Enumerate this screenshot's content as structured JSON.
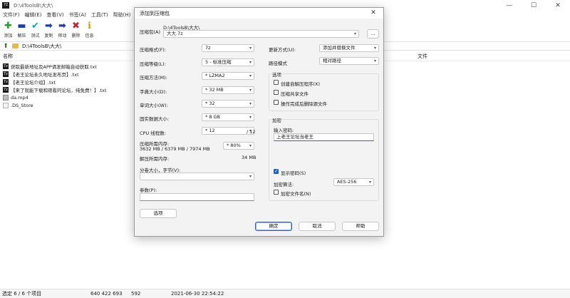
{
  "window": {
    "title": "D:\\4ToolsB\\大大\\",
    "icon_text": "7Z"
  },
  "menu": [
    "文件(F)",
    "编辑(E)",
    "查看(V)",
    "书签(A)",
    "工具(T)",
    "帮助(H)"
  ],
  "toolbar": [
    {
      "label": "添加",
      "icon": "plus-icon",
      "glyph": "✚",
      "color": "#2e9e2e"
    },
    {
      "label": "解压",
      "icon": "minus-icon",
      "glyph": "▬",
      "color": "#1f3fa8"
    },
    {
      "label": "测试",
      "icon": "check-icon",
      "glyph": "✔",
      "color": "#1aa3a3"
    },
    {
      "label": "复制",
      "icon": "arrow-right-icon",
      "glyph": "➡",
      "color": "#1f3fa8"
    },
    {
      "label": "移动",
      "icon": "arrow-right-icon",
      "glyph": "➡",
      "color": "#1f3fa8"
    },
    {
      "label": "删除",
      "icon": "delete-icon",
      "glyph": "✖",
      "color": "#c0262d"
    },
    {
      "label": "信息",
      "icon": "info-icon",
      "glyph": "ℹ",
      "color": "#c8a400"
    }
  ],
  "path": "D:\\4ToolsB\\大大\\",
  "list_header": {
    "name": "名称",
    "type": "文件"
  },
  "files": [
    {
      "name": "获取最新地址及APP请发邮箱自动获取.txt",
      "kind": "txt"
    },
    {
      "name": "【老王论坛永久地址发布页】.txt",
      "kind": "txt"
    },
    {
      "name": "【老王论坛介绍】.txt",
      "kind": "txt"
    },
    {
      "name": "【来了就能下载和观看的论坛，纯免费！】.txt",
      "kind": "txt"
    },
    {
      "name": "da.mp4",
      "kind": "mp4"
    },
    {
      "name": ".DS_Store",
      "kind": "ds"
    }
  ],
  "statusbar": {
    "selection": "选定 6 / 6 个项目",
    "size": "640 422 693",
    "packed": "592",
    "modified": "2021-06-30 22:54:22"
  },
  "dialog": {
    "title": "添加到压缩包",
    "archive_label": "压缩包(A)",
    "archive_dir": "D:\\4ToolsB\\大大\\",
    "archive_name": "大大.7z",
    "browse_label": "...",
    "format_label": "压缩格式(F):",
    "format_value": "7z",
    "level_label": "压缩等级(L):",
    "level_value": "5 - 标准压缩",
    "method_label": "压缩方法(M):",
    "method_value": "* LZMA2",
    "dict_label": "字典大小(D):",
    "dict_value": "* 32 MB",
    "word_label": "单词大小(W):",
    "word_value": "* 32",
    "solid_label": "固实数据大小:",
    "solid_value": "* 8 GB",
    "threads_label": "CPU 线程数:",
    "threads_value": "* 12",
    "threads_total": "/ 12",
    "mem_label": "压缩所需内存:",
    "mem_value": "3632 MB / 6379 MB / 7974 MB",
    "mem_percent": "* 80%",
    "decomp_label": "解压所需内存:",
    "decomp_value": "34 MB",
    "split_label": "分卷大小，字节(V):",
    "split_value": "",
    "params_label": "参数(P):",
    "params_value": "",
    "options_button": "选项",
    "update_label": "更新方式(U):",
    "update_value": "添加并替换文件",
    "pathmode_label": "路径模式",
    "pathmode_value": "相对路径",
    "options_group": "选项",
    "opt_sfx": "创建自解压程序(X)",
    "opt_shared": "压缩共享文件",
    "opt_delete": "操作完成后删除源文件",
    "encrypt_group": "加密",
    "pwd_label": "输入密码:",
    "pwd_value": "上老王论坛当老王",
    "show_pwd": "显示密码(S)",
    "enc_method_label": "加密算法:",
    "enc_method_value": "AES-256",
    "enc_names": "加密文件名(N)",
    "ok": "确定",
    "cancel": "取消",
    "help": "帮助"
  }
}
